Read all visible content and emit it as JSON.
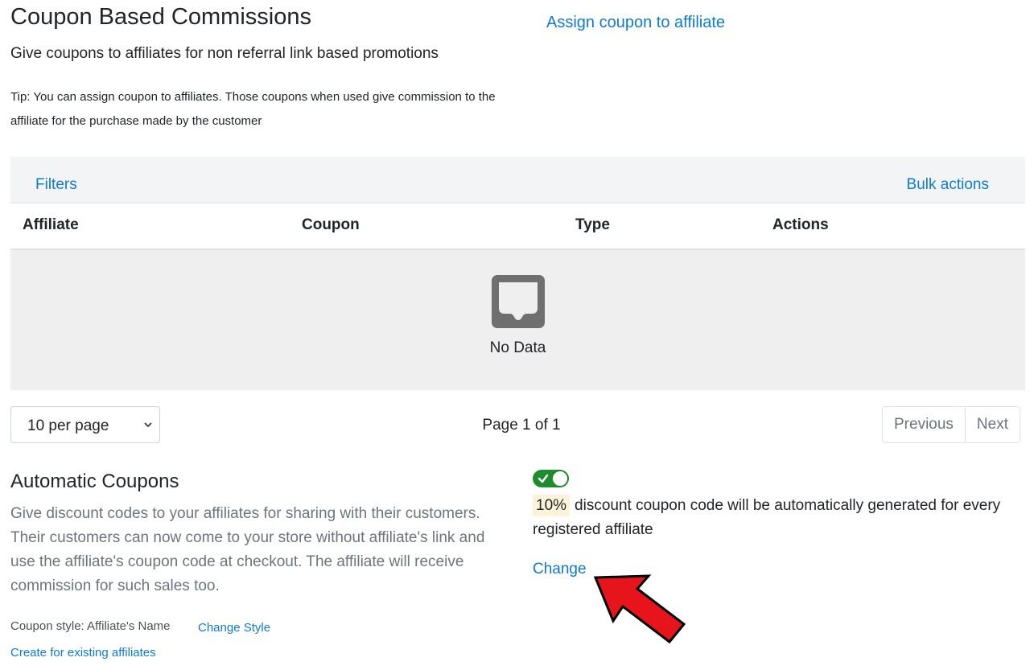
{
  "header": {
    "title": "Coupon Based Commissions",
    "assign_link": "Assign coupon to affiliate",
    "subtitle": "Give coupons to affiliates for non referral link based promotions",
    "tip": "Tip: You can assign coupon to affiliates. Those coupons when used give commission to the affiliate for the purchase made by the customer"
  },
  "table": {
    "filters_label": "Filters",
    "bulk_actions_label": "Bulk actions",
    "columns": [
      "Affiliate",
      "Coupon",
      "Type",
      "Actions"
    ],
    "rows": [],
    "empty_text": "No Data",
    "empty_icon": "inbox-icon"
  },
  "pagination": {
    "per_page": "10 per page",
    "page_info": "Page 1 of 1",
    "previous_label": "Previous",
    "next_label": "Next"
  },
  "automatic_coupons": {
    "title": "Automatic Coupons",
    "description": "Give discount codes to your affiliates for sharing with their customers. Their customers can now come to your store without affiliate's link and use the affiliate's coupon code at checkout. The affiliate will receive commission for such sales too.",
    "coupon_style_label": "Coupon style: Affiliate's Name",
    "change_style_label": "Change Style",
    "create_existing_label": "Create for existing affiliates",
    "enabled": true,
    "discount_percent": "10%",
    "discount_text": "discount coupon code will be automatically generated for every registered affiliate",
    "change_label": "Change"
  },
  "colors": {
    "link": "#0d7bd6",
    "toggle_on": "#1e8c2e",
    "annotation_arrow": "#e8141c",
    "badge_bg": "#fdf3d8"
  }
}
